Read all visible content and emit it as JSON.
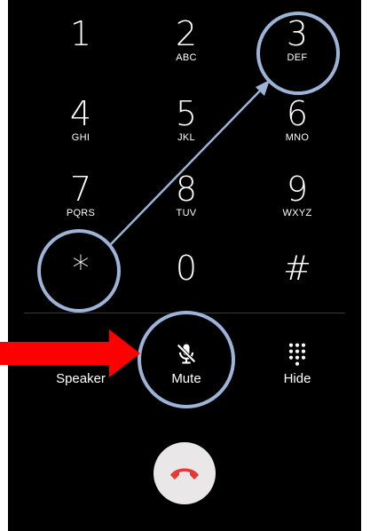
{
  "keypad": [
    {
      "digit": "1",
      "letters": ""
    },
    {
      "digit": "2",
      "letters": "ABC"
    },
    {
      "digit": "3",
      "letters": "DEF"
    },
    {
      "digit": "4",
      "letters": "GHI"
    },
    {
      "digit": "5",
      "letters": "JKL"
    },
    {
      "digit": "6",
      "letters": "MNO"
    },
    {
      "digit": "7",
      "letters": "PQRS"
    },
    {
      "digit": "8",
      "letters": "TUV"
    },
    {
      "digit": "9",
      "letters": "WXYZ"
    },
    {
      "digit": "*",
      "letters": ""
    },
    {
      "digit": "0",
      "letters": ""
    },
    {
      "digit": "#",
      "letters": ""
    }
  ],
  "actions": {
    "speaker": {
      "label": "Speaker",
      "icon": "speaker-icon"
    },
    "mute": {
      "label": "Mute",
      "icon": "mic-off-icon"
    },
    "hide": {
      "label": "Hide",
      "icon": "keypad-grid-icon"
    }
  },
  "end_call": {
    "icon": "phone-hangup-icon",
    "color": "#e53935"
  },
  "colors": {
    "screen_bg": "#000000",
    "text": "#ffffff",
    "annotation_circle": "#9db3d8",
    "annotation_arrow": "#ff0000"
  }
}
